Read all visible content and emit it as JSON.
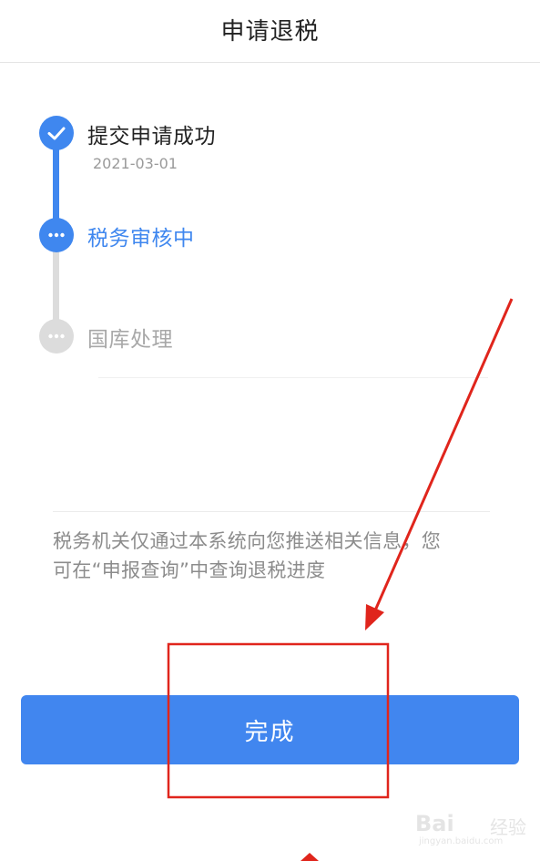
{
  "header": {
    "title": "申请退税"
  },
  "steps": [
    {
      "label": "提交申请成功",
      "date": "2021-03-01",
      "status": "done",
      "icon": "check-icon"
    },
    {
      "label": "税务审核中",
      "status": "current",
      "icon": "ellipsis-icon"
    },
    {
      "label": "国库处理",
      "status": "pending",
      "icon": "ellipsis-icon"
    }
  ],
  "notice": {
    "line1": "税务机关仅通过本系统向您推送相关信息，您",
    "line2": "可在“申报查询”中查询退税进度"
  },
  "done_button": {
    "label": "完成"
  },
  "watermark": {
    "brand": "Bai",
    "brand_cn": "经验",
    "url": "jingyan.baidu.com"
  },
  "colors": {
    "primary": "#3f87ef",
    "button": "#4186ef",
    "pending": "#dcdcdc",
    "done_text": "#222222",
    "date_text": "#9a9a9a",
    "pending_text": "#a8a8a8",
    "notice_text": "#8c8c8c",
    "annotation_red": "#e0251c"
  }
}
